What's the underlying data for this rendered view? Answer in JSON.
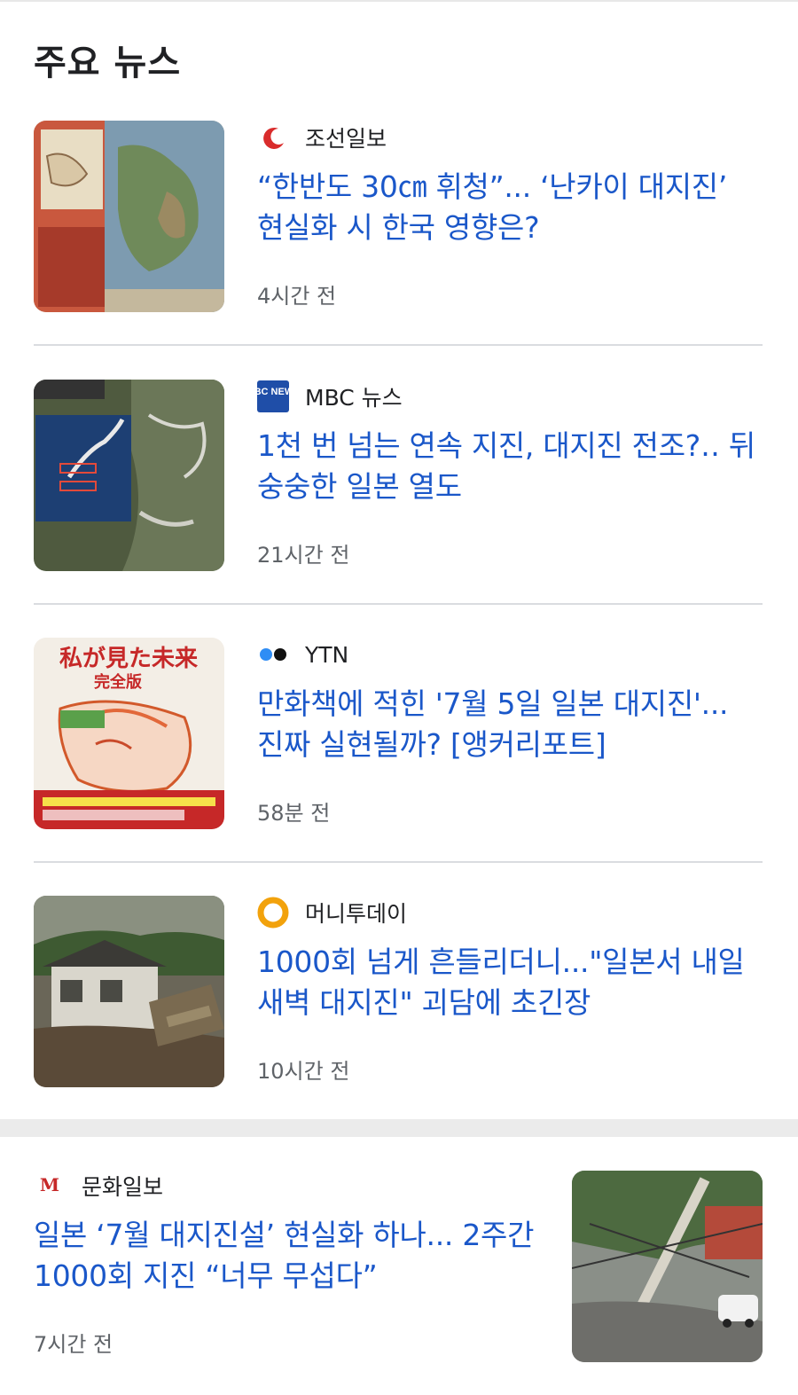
{
  "section": {
    "title": "주요 뉴스"
  },
  "articles": [
    {
      "source": "조선일보",
      "logo_icon": "chosun-crescent-icon",
      "headline": "“한반도 30㎝ 휘청”... ‘난카이 대지진’ 현실화 시 한국 영향은?",
      "time": "4시간 전"
    },
    {
      "source": "MBC 뉴스",
      "logo_icon": "mbc-news-icon",
      "logo_text": "MBC NEWS",
      "headline": "1천 번 넘는 연속 지진, 대지진 전조?‥ 뒤숭숭한 일본 열도",
      "time": "21시간 전"
    },
    {
      "source": "YTN",
      "logo_icon": "ytn-dots-icon",
      "headline": "만화책에 적힌 '7월 5일 일본 대지진'... 진짜 실현될까? [앵커리포트]",
      "time": "58분 전",
      "thumb_text": "私が見た未来",
      "thumb_subtext": "完全版"
    },
    {
      "source": "머니투데이",
      "logo_icon": "moneytoday-ring-icon",
      "headline": "1000회 넘게 흔들리더니...\"일본서 내일 새벽 대지진\" 괴담에 초긴장",
      "time": "10시간 전"
    }
  ],
  "bottom_article": {
    "source": "문화일보",
    "logo_icon": "munhwa-m-icon",
    "logo_text": "M",
    "headline": "일본 ‘7월 대지진설’ 현실화 하나... 2주간 1000회 지진 “너무 무섭다”",
    "time": "7시간 전"
  },
  "colors": {
    "headline": "#1a57c9",
    "meta": "#5f6368",
    "divider": "#dadce0"
  }
}
